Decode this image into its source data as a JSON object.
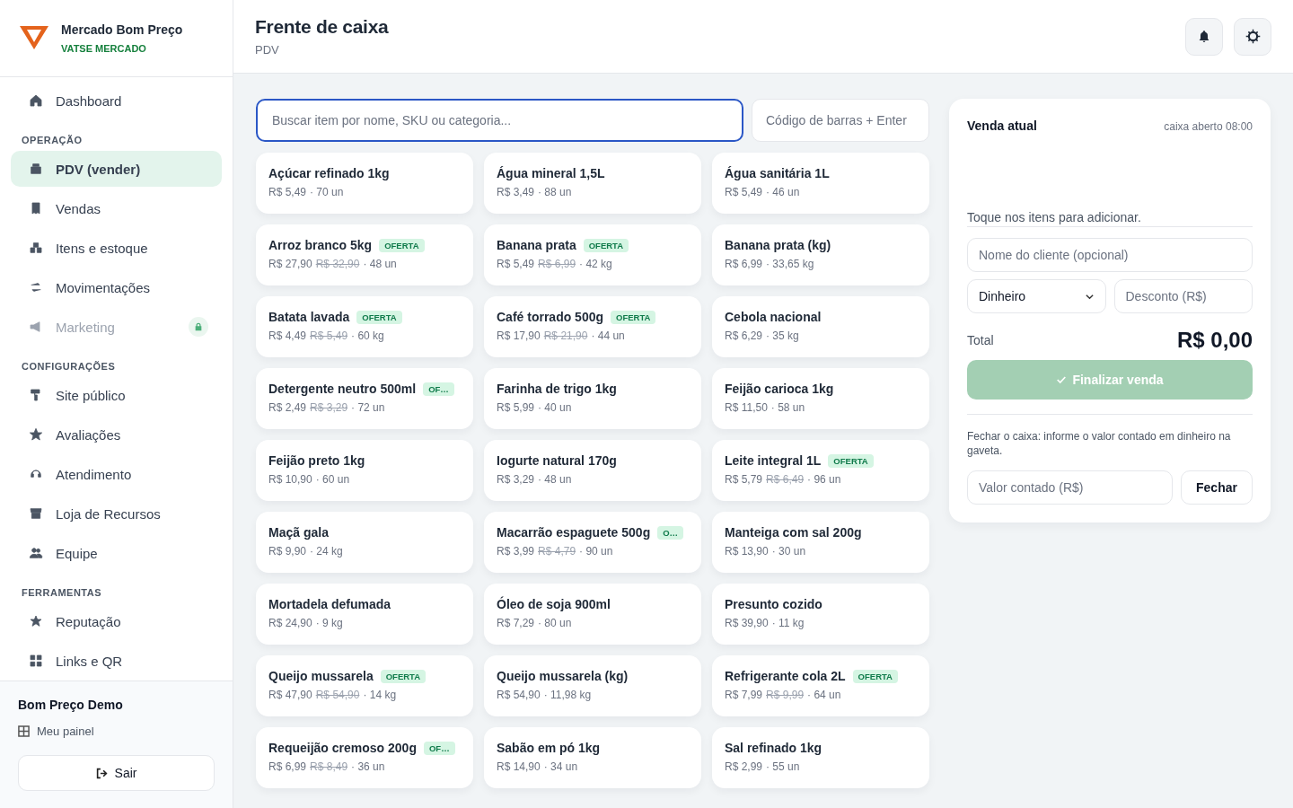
{
  "brand": {
    "name": "Mercado Bom Preço",
    "tagline": "VATSE MERCADO"
  },
  "sidebar": {
    "sections": [
      {
        "items": [
          {
            "label": "Dashboard",
            "selected": false,
            "disabled": false,
            "locked": false
          }
        ]
      },
      {
        "heading": "OPERAÇÃO",
        "items": [
          {
            "label": "PDV (vender)",
            "selected": true,
            "disabled": false,
            "locked": false
          },
          {
            "label": "Vendas",
            "selected": false,
            "disabled": false,
            "locked": false
          },
          {
            "label": "Itens e estoque",
            "selected": false,
            "disabled": false,
            "locked": false
          },
          {
            "label": "Movimentações",
            "selected": false,
            "disabled": false,
            "locked": false
          },
          {
            "label": "Marketing",
            "selected": false,
            "disabled": true,
            "locked": true
          }
        ]
      },
      {
        "heading": "CONFIGURAÇÕES",
        "items": [
          {
            "label": "Site público",
            "selected": false,
            "disabled": false,
            "locked": false
          },
          {
            "label": "Avaliações",
            "selected": false,
            "disabled": false,
            "locked": false
          },
          {
            "label": "Atendimento",
            "selected": false,
            "disabled": false,
            "locked": false
          },
          {
            "label": "Loja de Recursos",
            "selected": false,
            "disabled": false,
            "locked": false
          },
          {
            "label": "Equipe",
            "selected": false,
            "disabled": false,
            "locked": false
          }
        ]
      },
      {
        "heading": "FERRAMENTAS",
        "items": [
          {
            "label": "Reputação",
            "selected": false,
            "disabled": false,
            "locked": false
          },
          {
            "label": "Links e QR",
            "selected": false,
            "disabled": false,
            "locked": false
          }
        ]
      }
    ],
    "footer": {
      "user": "Bom Preço Demo",
      "panel_link": "Meu painel",
      "logout": "Sair"
    }
  },
  "header": {
    "title": "Frente de caixa",
    "subtitle": "PDV"
  },
  "search": {
    "placeholder": "Buscar item por nome, SKU ou categoria...",
    "focused": true
  },
  "barcode": {
    "placeholder": "Código de barras + Enter"
  },
  "products": [
    {
      "name": "Açúcar refinado 1kg",
      "price": "R$ 5,49",
      "stock": "· 70 un"
    },
    {
      "name": "Água mineral 1,5L",
      "price": "R$ 3,49",
      "stock": "· 88 un"
    },
    {
      "name": "Água sanitária 1L",
      "price": "R$ 5,49",
      "stock": "· 46 un"
    },
    {
      "name": "Arroz branco 5kg",
      "badge": "OFERTA",
      "price": "R$ 27,90",
      "old_price": "R$ 32,90",
      "stock": "· 48 un"
    },
    {
      "name": "Banana prata",
      "badge": "OFERTA",
      "price": "R$ 5,49",
      "old_price": "R$ 6,99",
      "stock": "· 42 kg"
    },
    {
      "name": "Banana prata (kg)",
      "price": "R$ 6,99",
      "stock": "· 33,65 kg"
    },
    {
      "name": "Batata lavada",
      "badge": "OFERTA",
      "price": "R$ 4,49",
      "old_price": "R$ 5,49",
      "stock": "· 60 kg"
    },
    {
      "name": "Café torrado 500g",
      "badge": "OFERTA",
      "price": "R$ 17,90",
      "old_price": "R$ 21,90",
      "stock": "· 44 un"
    },
    {
      "name": "Cebola nacional",
      "price": "R$ 6,29",
      "stock": "· 35 kg"
    },
    {
      "name": "Detergente neutro 500ml",
      "badge": "OF…",
      "price": "R$ 2,49",
      "old_price": "R$ 3,29",
      "stock": "· 72 un"
    },
    {
      "name": "Farinha de trigo 1kg",
      "price": "R$ 5,99",
      "stock": "· 40 un"
    },
    {
      "name": "Feijão carioca 1kg",
      "price": "R$ 11,50",
      "stock": "· 58 un"
    },
    {
      "name": "Feijão preto 1kg",
      "price": "R$ 10,90",
      "stock": "· 60 un"
    },
    {
      "name": "Iogurte natural 170g",
      "price": "R$ 3,29",
      "stock": "· 48 un"
    },
    {
      "name": "Leite integral 1L",
      "badge": "OFERTA",
      "price": "R$ 5,79",
      "old_price": "R$ 6,49",
      "stock": "· 96 un"
    },
    {
      "name": "Maçã gala",
      "price": "R$ 9,90",
      "stock": "· 24 kg"
    },
    {
      "name": "Macarrão espaguete 500g",
      "badge": "O…",
      "price": "R$ 3,99",
      "old_price": "R$ 4,79",
      "stock": "· 90 un"
    },
    {
      "name": "Manteiga com sal 200g",
      "price": "R$ 13,90",
      "stock": "· 30 un"
    },
    {
      "name": "Mortadela defumada",
      "price": "R$ 24,90",
      "stock": "· 9 kg"
    },
    {
      "name": "Óleo de soja 900ml",
      "price": "R$ 7,29",
      "stock": "· 80 un"
    },
    {
      "name": "Presunto cozido",
      "price": "R$ 39,90",
      "stock": "· 11 kg"
    },
    {
      "name": "Queijo mussarela",
      "badge": "OFERTA",
      "price": "R$ 47,90",
      "old_price": "R$ 54,90",
      "stock": "· 14 kg"
    },
    {
      "name": "Queijo mussarela (kg)",
      "price": "R$ 54,90",
      "stock": "· 11,98 kg"
    },
    {
      "name": "Refrigerante cola 2L",
      "badge": "OFERTA",
      "price": "R$ 7,99",
      "old_price": "R$ 9,99",
      "stock": "· 64 un"
    },
    {
      "name": "Requeijão cremoso 200g",
      "badge": "OF…",
      "price": "R$ 6,99",
      "old_price": "R$ 8,49",
      "stock": "· 36 un"
    },
    {
      "name": "Sabão em pó 1kg",
      "price": "R$ 14,90",
      "stock": "· 34 un"
    },
    {
      "name": "Sal refinado 1kg",
      "price": "R$ 2,99",
      "stock": "· 55 un"
    }
  ],
  "sale": {
    "title": "Venda atual",
    "status": "caixa aberto 08:00",
    "empty_hint": "Toque nos itens para adicionar.",
    "customer_placeholder": "Nome do cliente (opcional)",
    "payment": "Dinheiro",
    "discount_placeholder": "Desconto (R$)",
    "total_label": "Total",
    "total": "R$ 0,00",
    "finalize": {
      "label": "Finalizar venda",
      "disabled": true
    },
    "close_note": "Fechar o caixa: informe o valor contado em dinheiro na gaveta.",
    "counted_placeholder": "Valor contado (R$)",
    "close_button": "Fechar"
  }
}
